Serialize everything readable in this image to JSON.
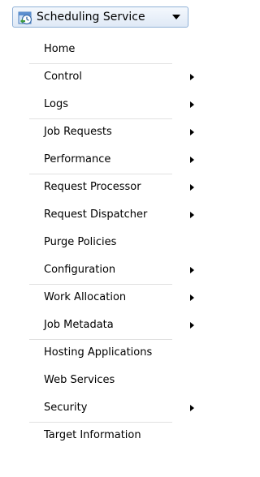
{
  "header": {
    "title": "Scheduling Service",
    "icon": "scheduling-service-icon",
    "dropdown_icon": "caret-down-icon"
  },
  "menu": {
    "items": [
      {
        "label": "Home",
        "has_submenu": false
      },
      {
        "label": "Control",
        "has_submenu": true
      },
      {
        "label": "Logs",
        "has_submenu": true
      },
      {
        "label": "Job Requests",
        "has_submenu": true
      },
      {
        "label": "Performance",
        "has_submenu": true
      },
      {
        "label": "Request Processor",
        "has_submenu": true
      },
      {
        "label": "Request Dispatcher",
        "has_submenu": true
      },
      {
        "label": "Purge Policies",
        "has_submenu": false
      },
      {
        "label": "Configuration",
        "has_submenu": true
      },
      {
        "label": "Work Allocation",
        "has_submenu": true
      },
      {
        "label": "Job Metadata",
        "has_submenu": true
      },
      {
        "label": "Hosting Applications",
        "has_submenu": false
      },
      {
        "label": "Web Services",
        "has_submenu": false
      },
      {
        "label": "Security",
        "has_submenu": true
      },
      {
        "label": "Target Information",
        "has_submenu": false
      }
    ]
  },
  "colors": {
    "header_border": "#8fb0d6",
    "header_background": "#e6eef9",
    "menu_text": "#000000",
    "divider": "#e1e1e1"
  }
}
